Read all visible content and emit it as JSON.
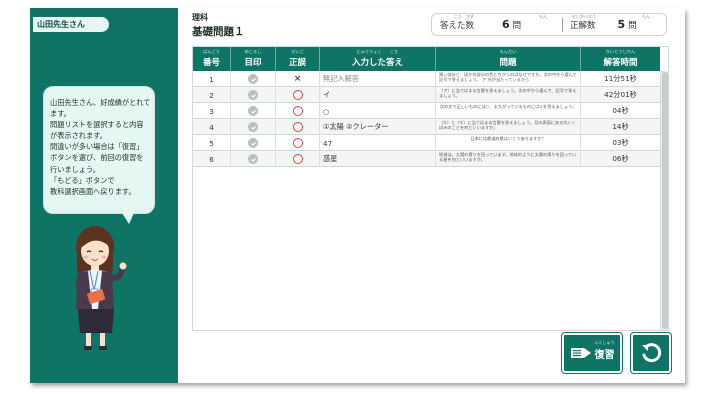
{
  "user": {
    "name": "山田先生さん"
  },
  "bubble": {
    "lines": [
      "山田先生さん、好成績がとれて",
      "ます。",
      "問題リストを選択すると内容",
      "が表示されます。",
      "間違いが多い場合は「復習」",
      "ボタンを選び、前回の復習を",
      "行いましょう。",
      "「もどる」ボタンで",
      "教科選択画面へ戻ります。"
    ]
  },
  "header": {
    "subject": "理科",
    "title": "基礎問題１",
    "answered_label": "答えた数",
    "answered_value": "6",
    "answered_unit": "問",
    "correct_label": "正解数",
    "correct_value": "5",
    "correct_unit": "問",
    "ruby_answered": "こた　かず",
    "ruby_answered_unit": "もん",
    "ruby_correct": "せいかいすう",
    "ruby_correct_unit": "もん"
  },
  "table": {
    "columns": [
      {
        "label": "番号",
        "ruby": "ばんごう"
      },
      {
        "label": "目印",
        "ruby": "めじるし"
      },
      {
        "label": "正誤",
        "ruby": "せいご"
      },
      {
        "label": "入力した答え",
        "ruby": "にゅうりょく　　こた"
      },
      {
        "label": "問題",
        "ruby": "もんだい"
      },
      {
        "label": "解答時間",
        "ruby": "かいとうじかん"
      }
    ],
    "rows": [
      {
        "no": "1",
        "result": "wrong",
        "answer": "無記入解答",
        "question": "黒い部分と、ほかの部分の色とちがうのはなぜですか。次の中から選んで記号で答えましょう。 ア 光が当たっているから",
        "time": "11分51秒"
      },
      {
        "no": "2",
        "result": "correct",
        "answer": "イ",
        "question": "（ア）に当てはまる言葉を答えましょう。次の中から選んで、記号で答えましょう。",
        "time": "42分01秒"
      },
      {
        "no": "3",
        "result": "correct",
        "answer": "○",
        "question": "次の文で正しいものには○、まちがっているものには×を答えましょう。",
        "time": "04秒"
      },
      {
        "no": "4",
        "result": "correct",
        "answer": "①太陽 ②クレーター",
        "question": "（①）と（②）に当てはまる言葉を答えましょう。月の表面にある丸いくぼみのことを何といいますか。",
        "time": "14秒"
      },
      {
        "no": "5",
        "result": "correct",
        "answer": "47",
        "question": "日本には都道府県はいくつありますか？",
        "time": "03秒"
      },
      {
        "no": "6",
        "result": "correct",
        "answer": "惑星",
        "question": "地球は、太陽の周りを回っています。地球のように太陽の周りを回っている星を何といいますか。",
        "time": "06秒"
      }
    ]
  },
  "buttons": {
    "review_label": "復習",
    "review_ruby": "ふくしゅう"
  },
  "colors": {
    "accent": "#0e7466",
    "correct_mark": "#e0443e",
    "wrong_mark": "#3b48c9"
  }
}
